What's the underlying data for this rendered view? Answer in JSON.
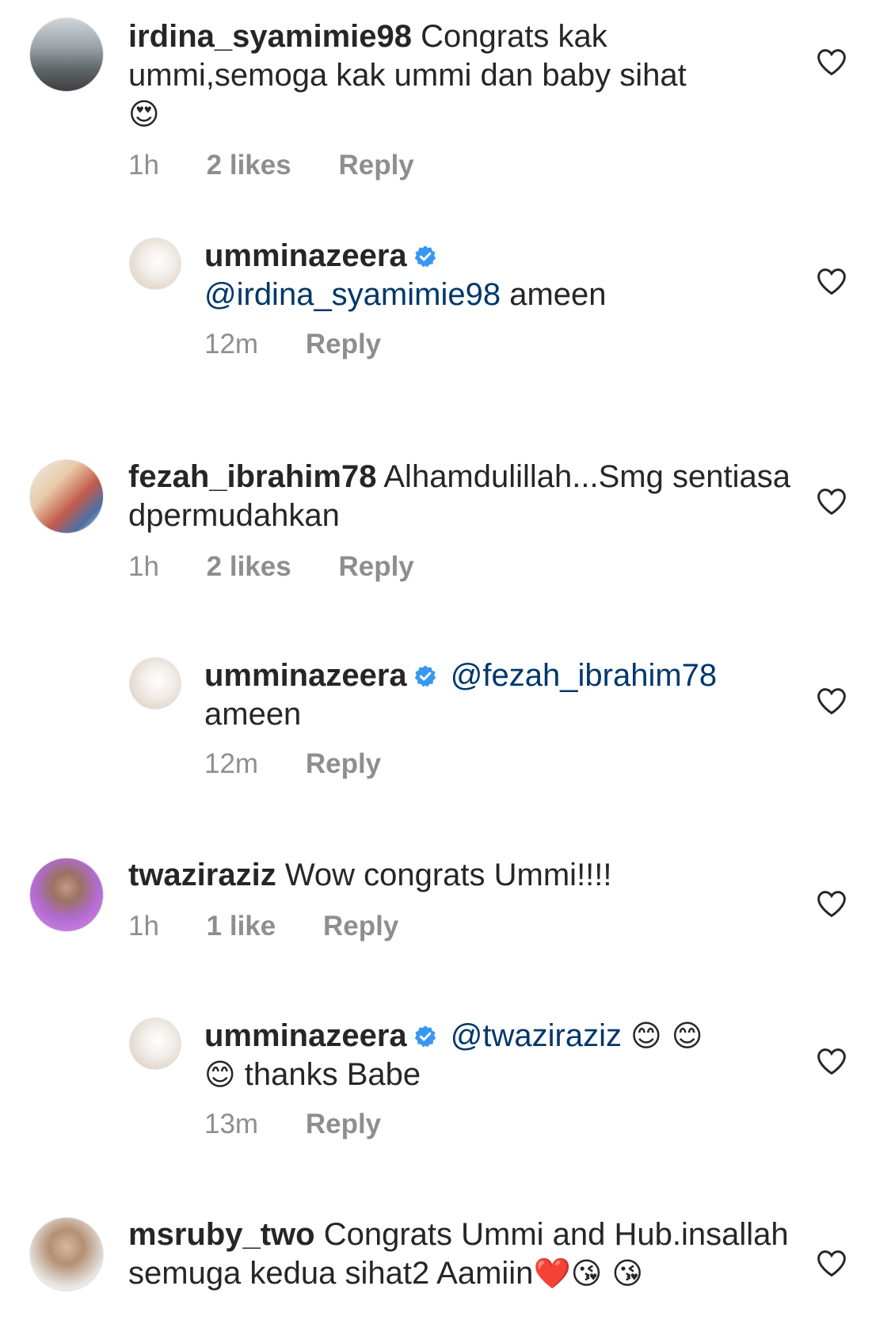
{
  "comments": [
    {
      "username": "irdina_syamimie98",
      "text": "Congrats kak ummi,semoga kak ummi dan baby sihat",
      "emoji": "😍",
      "time": "1h",
      "likes": "2 likes",
      "reply": "Reply"
    },
    {
      "username": "umminazeera",
      "mention": "@irdina_syamimie98",
      "text": "ameen",
      "time": "12m",
      "reply": "Reply"
    },
    {
      "username": "fezah_ibrahim78",
      "text": "Alhamdulillah...Smg sentiasa dpermudahkan",
      "time": "1h",
      "likes": "2 likes",
      "reply": "Reply"
    },
    {
      "username": "umminazeera",
      "mention": "@fezah_ibrahim78",
      "text": "ameen",
      "time": "12m",
      "reply": "Reply"
    },
    {
      "username": "twaziraziz",
      "text": "Wow congrats Ummi!!!!",
      "time": "1h",
      "likes": "1 like",
      "reply": "Reply"
    },
    {
      "username": "umminazeera",
      "mention": "@twaziraziz",
      "emoji_a": "😊 😊",
      "emoji_b": "😊",
      "text": "thanks Babe",
      "time": "13m",
      "reply": "Reply"
    },
    {
      "username": "msruby_two",
      "text": "Congrats Ummi and Hub.insallah semuga kedua sihat2 Aamiin",
      "emoji": "❤️😘 😘"
    }
  ],
  "colors": {
    "username": "#262626",
    "meta": "#8e8e8e",
    "mention": "#00376b",
    "verified": "#3897f0"
  },
  "icons": [
    "heart-outline-icon",
    "verified-badge-icon"
  ]
}
